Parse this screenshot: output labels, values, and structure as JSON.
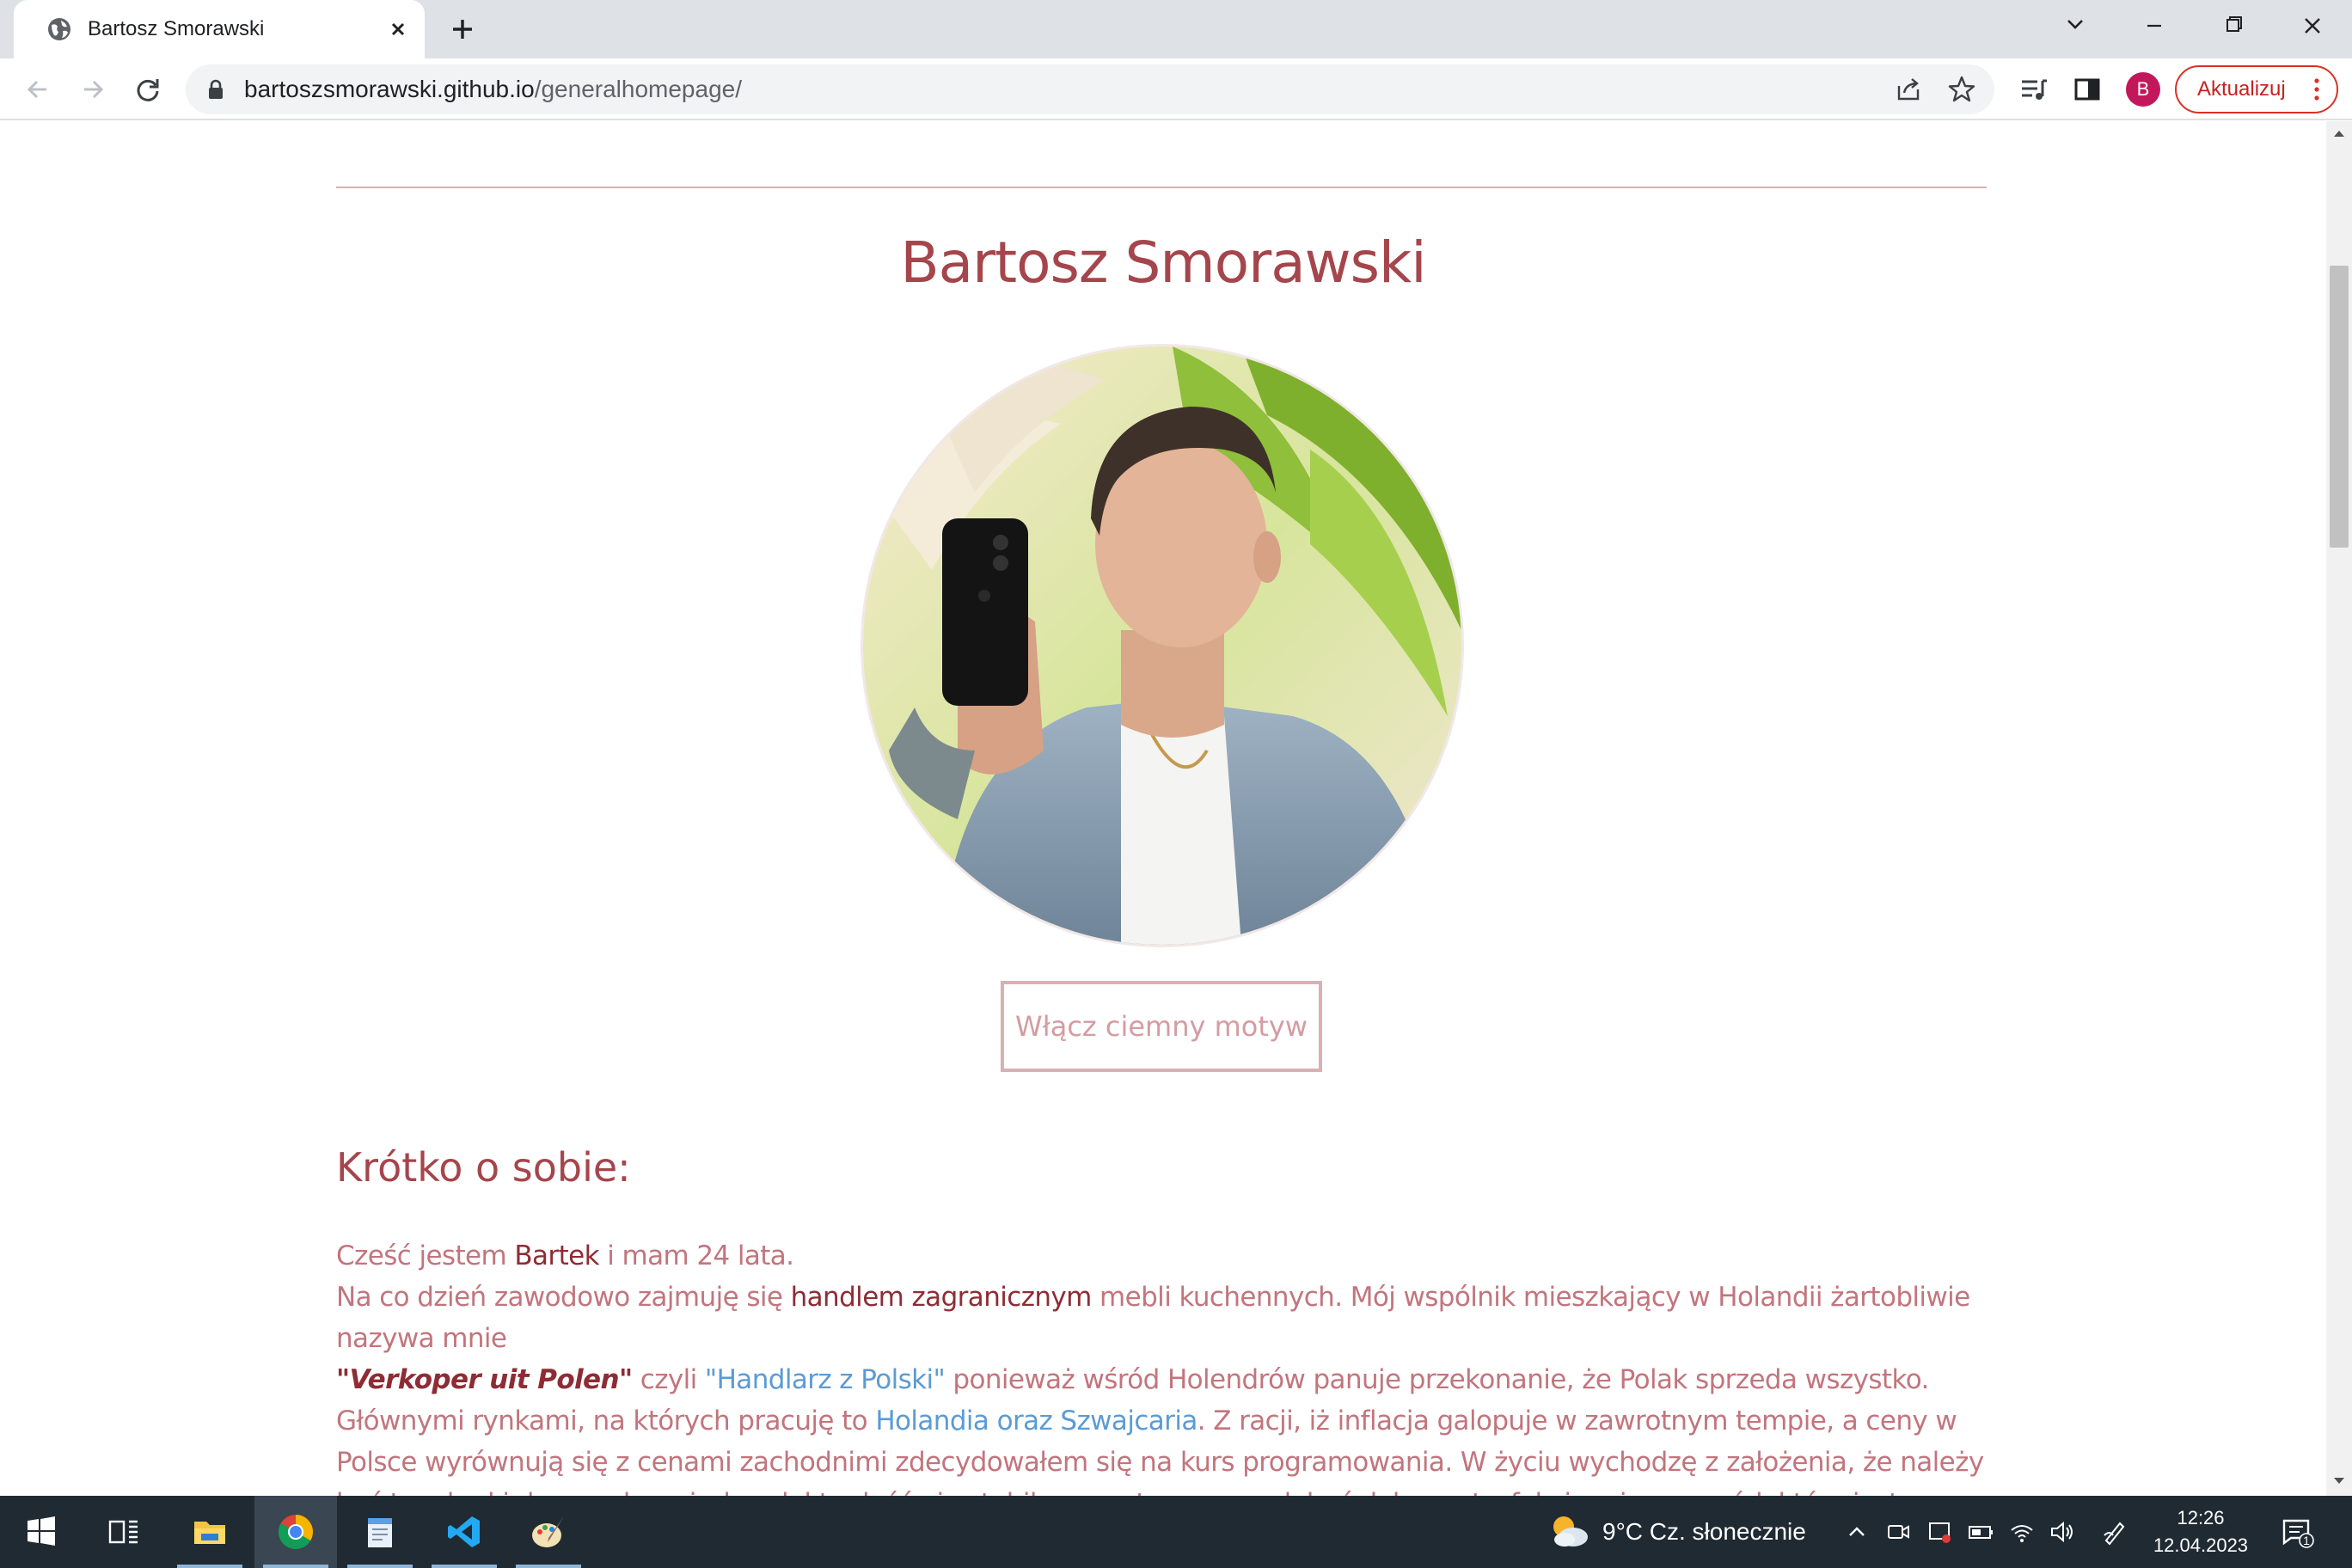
{
  "browser": {
    "tab_title": "Bartosz Smorawski",
    "url_host": "bartoszsmorawski.github.io",
    "url_path": "/generalhomepage/",
    "profile_initial": "B",
    "update_label": "Aktualizuj"
  },
  "page": {
    "name": "Bartosz Smorawski",
    "theme_button": "Włącz ciemny motyw",
    "about_heading": "Krótko o sobie:",
    "about": {
      "p1_a": "Cześć jestem ",
      "p1_name": "Bartek",
      "p1_b": " i mam 24 lata.",
      "p2_a": "Na co dzień zawodowo zajmuję się ",
      "p2_trade": "handlem zagranicznym",
      "p2_b": " mebli kuchennych. Mój wspólnik mieszkający w Holandii żartobliwie nazywa mnie ",
      "p2_nick": "\"Verkoper uit Polen\"",
      "p2_c": " czyli ",
      "p2_link1": "\"Handlarz z Polski\"",
      "p2_d": " ponieważ wśród Holendrów panuje przekonanie, że Polak sprzeda wszystko. Głównymi rynkami, na których pracuję to ",
      "p2_link2": "Holandia oraz Szwajcaria",
      "p2_e": ". Z racji, iż inflacja galopuje w zawrotnym tempie, a ceny w Polsce wyrównują się z cenami zachodnimi zdecydowałem się na kurs programowania. W życiu wychodzę z założenia, że należy być trzy kroki do przodu, a że handel to dość nie stabilny grunt, pragnę zdobyć dobry satysfakcjonujący zawód, który jest przyszłościowy i rozszerza możliwości."
    }
  },
  "taskbar": {
    "weather": "9°C  Cz. słonecznie",
    "time": "12:26",
    "date": "12.04.2023",
    "notification_count": "1",
    "apps": [
      "start-icon",
      "task-view-icon",
      "file-explorer-icon",
      "chrome-icon",
      "notepad-icon",
      "vscode-icon",
      "paint-icon"
    ]
  },
  "colors": {
    "accent": "#a5454c",
    "body_text": "#c2757d",
    "link": "#5b9bd5",
    "divider": "#d9b0b3"
  }
}
